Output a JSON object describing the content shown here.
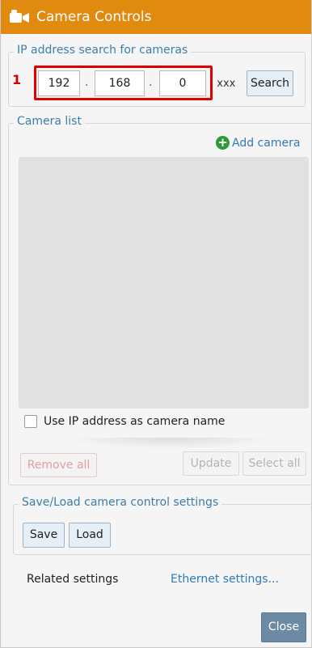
{
  "window": {
    "title": "Camera Controls",
    "title_icon": "camera-icon",
    "accent": "#e08a10"
  },
  "ip_search": {
    "legend": "IP address search for cameras",
    "marker": "1",
    "octets": [
      "192",
      "168",
      "0"
    ],
    "dot": ".",
    "suffix": ". xxx",
    "search_label": "Search"
  },
  "camera_list": {
    "legend": "Camera list",
    "add_label": "Add camera",
    "use_ip_label": "Use IP address as camera name",
    "remove_all_label": "Remove all",
    "update_label": "Update",
    "select_all_label": "Select all"
  },
  "save_load": {
    "legend": "Save/Load camera control settings",
    "save_label": "Save",
    "load_label": "Load"
  },
  "related": {
    "label": "Related settings",
    "ethernet_link": "Ethernet settings..."
  },
  "footer": {
    "close_label": "Close"
  }
}
